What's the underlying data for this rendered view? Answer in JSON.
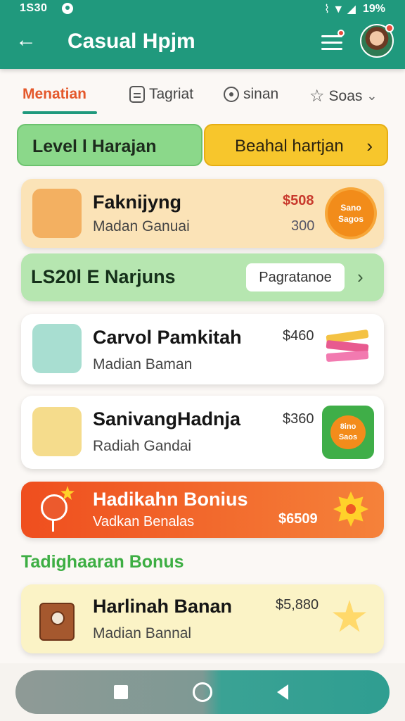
{
  "status": {
    "time": "1S30",
    "signal": "⌇ ▼ ◢",
    "battery": "19%"
  },
  "app": {
    "title": "Casual Hpjm"
  },
  "tabs": [
    {
      "label": "Menatian"
    },
    {
      "label": "Tagriat"
    },
    {
      "label": "sinan"
    },
    {
      "label": "Soas"
    }
  ],
  "pills": {
    "left": "Level l Harajan",
    "right": "Beahal hartjan"
  },
  "cards": {
    "c1": {
      "title": "Faknijyng",
      "sub": "Madan Ganuai",
      "price1": "$508",
      "price2": "300",
      "badge_top": "Sano",
      "badge_bottom": "Sagos"
    },
    "c2": {
      "title": "LS20l  E Narjuns",
      "button": "Pagratanoe"
    },
    "c3": {
      "title": "Carvol Pamkitah",
      "sub": "Madian Baman",
      "price": "$460"
    },
    "c4": {
      "title": "SanivangHadnja",
      "sub": "Radiah Gandai",
      "price": "$360",
      "badge_top": "8ino",
      "badge_bottom": "Saos"
    },
    "c5": {
      "title": "Hadikahn Bonius",
      "sub": "Vadkan Benalas",
      "price": "$6509"
    },
    "c6": {
      "title": "Harlinah Banan",
      "sub": "Madian Bannal",
      "price": "$5,880"
    }
  },
  "section_title": "Tadighaaran Bonus",
  "colors": {
    "primary": "#20997d",
    "accent_orange": "#ef4e1e",
    "accent_yellow": "#f7c62c",
    "green": "#8bd88a"
  }
}
